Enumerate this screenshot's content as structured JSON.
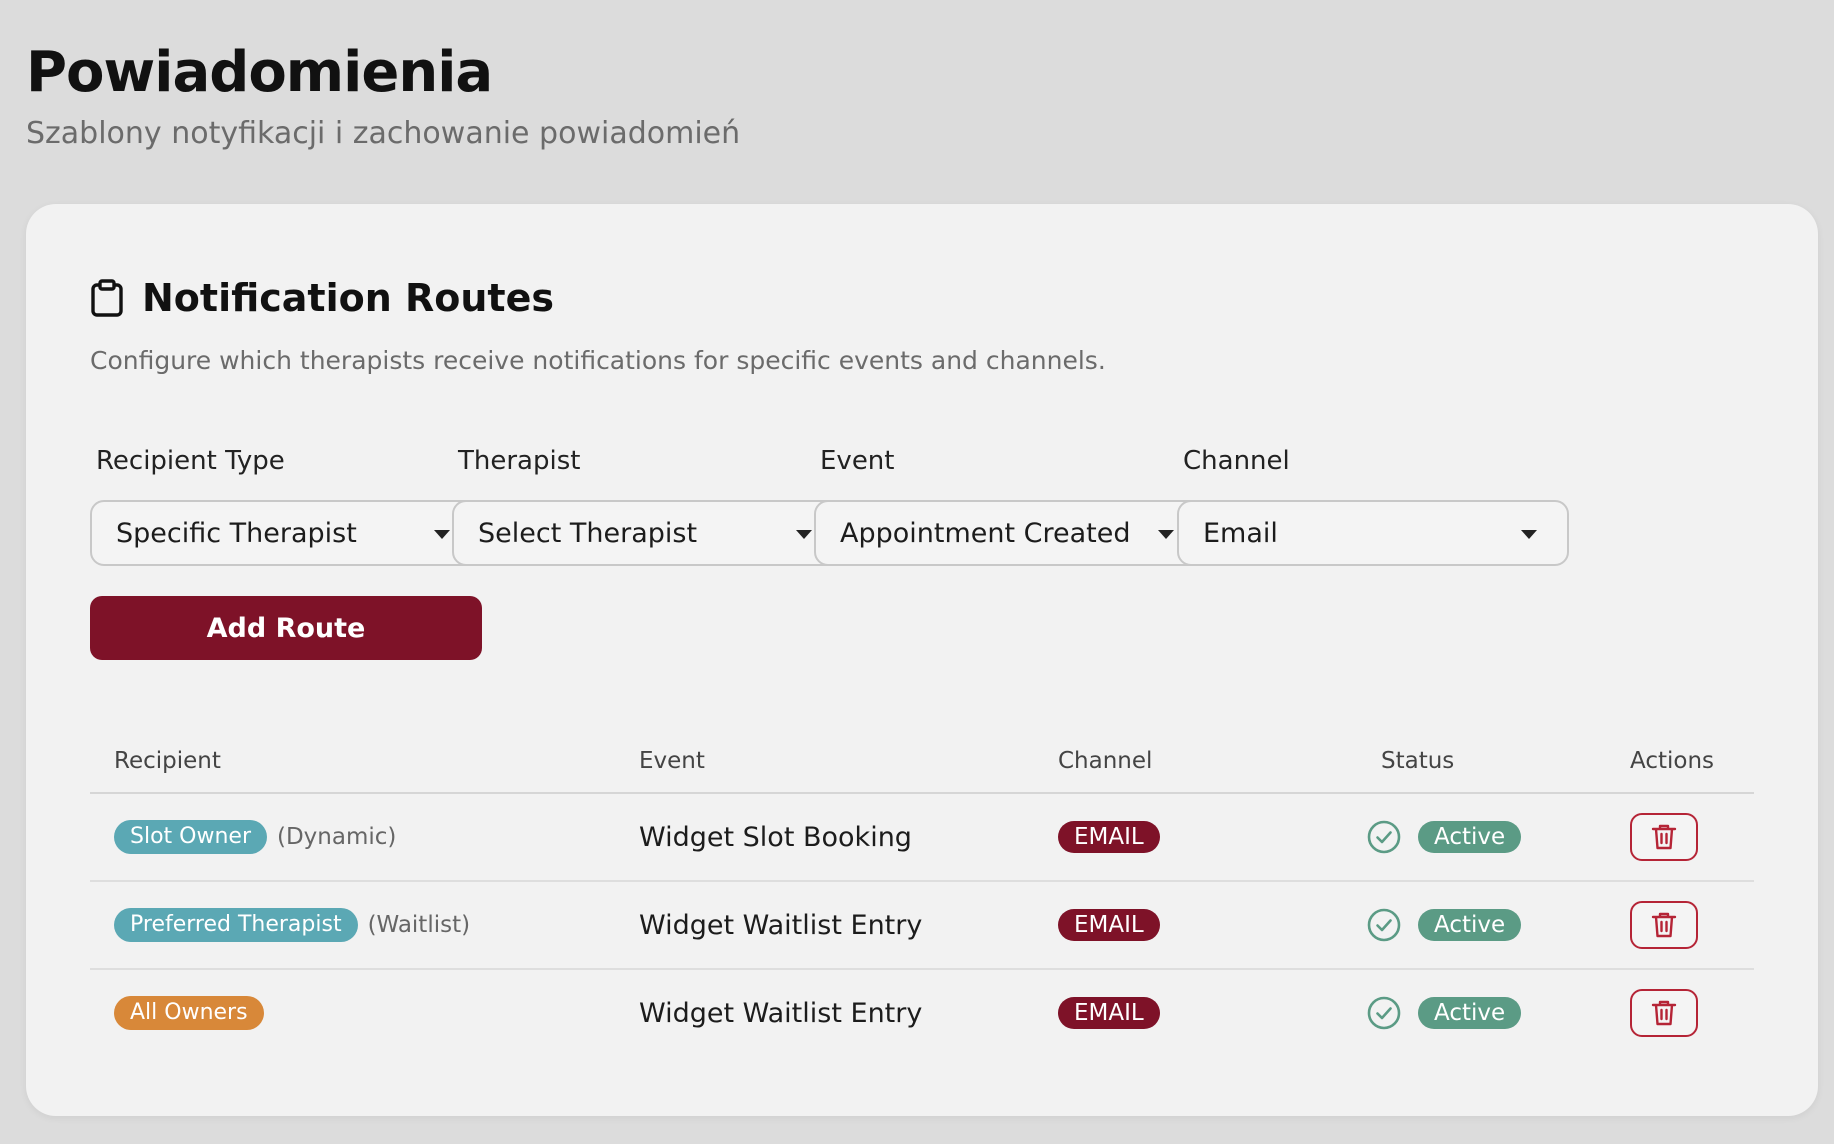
{
  "header": {
    "title": "Powiadomienia",
    "subtitle": "Szablony notyfikacji i zachowanie powiadomień"
  },
  "card": {
    "title": "Notification Routes",
    "description": "Configure which therapists receive notifications for specific events and channels."
  },
  "form": {
    "recipient_type": {
      "label": "Recipient Type",
      "value": "Specific Therapist"
    },
    "therapist": {
      "label": "Therapist",
      "value": "Select Therapist"
    },
    "event": {
      "label": "Event",
      "value": "Appointment Created"
    },
    "channel": {
      "label": "Channel",
      "value": "Email"
    },
    "add_button": "Add Route"
  },
  "table": {
    "headers": [
      "Recipient",
      "Event",
      "Channel",
      "Status",
      "Actions"
    ],
    "rows": [
      {
        "recipient": "Slot Owner",
        "note": "(Dynamic)",
        "event": "Widget Slot Booking",
        "channel": "EMAIL",
        "status": "Active"
      },
      {
        "recipient": "Preferred Therapist",
        "note": "(Waitlist)",
        "event": "Widget Waitlist Entry",
        "channel": "EMAIL",
        "status": "Active"
      },
      {
        "recipient": "All Owners",
        "note": "",
        "event": "Widget Waitlist Entry",
        "channel": "EMAIL",
        "status": "Active"
      }
    ]
  },
  "icons": {
    "card_icon": "clipboard-icon",
    "status_icon": "check-circle-icon",
    "delete_icon": "trash-icon",
    "dropdown_icon": "caret-down-icon"
  },
  "colors": {
    "accent": "#7e1228",
    "teal_pill": "#5ba8b4",
    "orange_pill": "#d88839",
    "active_pill": "#5b9b85",
    "delete_border": "#b52436"
  }
}
